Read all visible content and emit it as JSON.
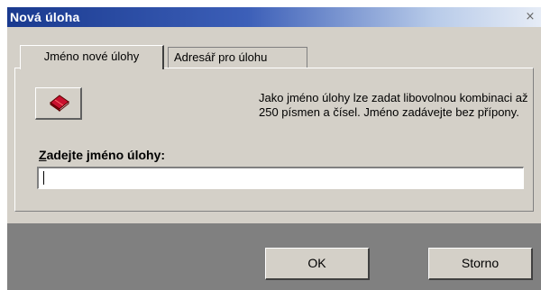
{
  "window": {
    "title": "Nová úloha",
    "close_glyph": "×"
  },
  "tabs": [
    {
      "label": "Jméno nové úlohy",
      "active": true
    },
    {
      "label": "Adresář pro úlohu",
      "active": false
    }
  ],
  "panel": {
    "icon": "red-book-icon",
    "info_text": "Jako jméno úlohy lze zadat libovolnou kombinaci až 250 písmen a čísel. Jméno zadávejte bez přípony.",
    "label_accel": "Z",
    "label_rest": "adejte jméno úlohy:",
    "input_value": "",
    "input_placeholder": ""
  },
  "buttons": {
    "ok_label": "OK",
    "cancel_label": "Storno"
  },
  "colors": {
    "dialog_face": "#d4d0c8",
    "footer_bg": "#808080",
    "title_start": "#1a3a8f",
    "title_end": "#e6ecf6",
    "book_red": "#c8102e"
  }
}
